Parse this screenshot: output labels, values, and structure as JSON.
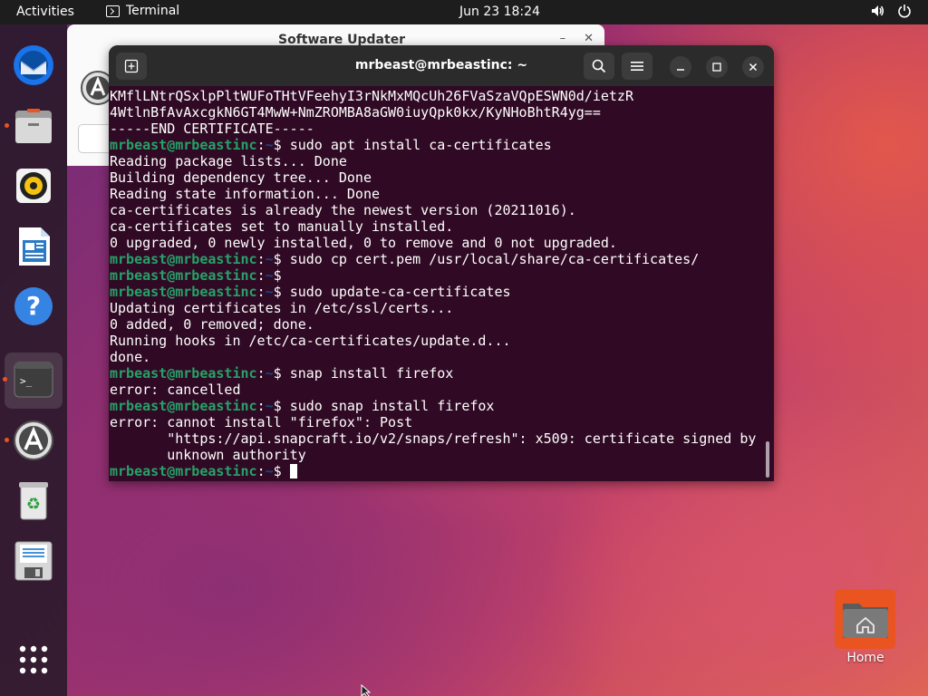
{
  "topbar": {
    "activities": "Activities",
    "app_name": "Terminal",
    "clock": "Jun 23  18:24"
  },
  "dock": {
    "items": [
      "thunderbird-icon",
      "files-icon",
      "rhythmbox-icon",
      "libreoffice-writer-icon",
      "help-icon",
      "terminal-icon",
      "software-updater-icon",
      "trash-icon",
      "floppy-save-icon",
      "show-apps-icon"
    ]
  },
  "updater": {
    "title": "Software Updater"
  },
  "terminal": {
    "title": "mrbeast@mrbeastinc: ~",
    "prompt_user": "mrbeast@mrbeastinc",
    "prompt_sep": ":",
    "prompt_path": "~",
    "prompt_end": "$ ",
    "lines": [
      {
        "kind": "out",
        "text": "KMflLNtrQSxlpPltWUFoTHtVFeehyI3rNkMxMQcUh26FVaSzaVQpESWN0d/ietzR"
      },
      {
        "kind": "out",
        "text": "4WtlnBfAvAxcgkN6GT4MwW+NmZROMBA8aGW0iuyQpk0kx/KyNHoBhtR4yg=="
      },
      {
        "kind": "out",
        "text": "-----END CERTIFICATE-----"
      },
      {
        "kind": "cmd",
        "text": "sudo apt install ca-certificates"
      },
      {
        "kind": "out",
        "text": "Reading package lists... Done"
      },
      {
        "kind": "out",
        "text": "Building dependency tree... Done"
      },
      {
        "kind": "out",
        "text": "Reading state information... Done"
      },
      {
        "kind": "out",
        "text": "ca-certificates is already the newest version (20211016)."
      },
      {
        "kind": "out",
        "text": "ca-certificates set to manually installed."
      },
      {
        "kind": "out",
        "text": "0 upgraded, 0 newly installed, 0 to remove and 0 not upgraded."
      },
      {
        "kind": "cmd",
        "text": "sudo cp cert.pem /usr/local/share/ca-certificates/"
      },
      {
        "kind": "cmd",
        "text": ""
      },
      {
        "kind": "cmd",
        "text": "sudo update-ca-certificates"
      },
      {
        "kind": "out",
        "text": "Updating certificates in /etc/ssl/certs..."
      },
      {
        "kind": "out",
        "text": "0 added, 0 removed; done."
      },
      {
        "kind": "out",
        "text": "Running hooks in /etc/ca-certificates/update.d..."
      },
      {
        "kind": "out",
        "text": "done."
      },
      {
        "kind": "cmd",
        "text": "snap install firefox"
      },
      {
        "kind": "out",
        "text": "error: cancelled"
      },
      {
        "kind": "cmd",
        "text": "sudo snap install firefox"
      },
      {
        "kind": "out",
        "text": "error: cannot install \"firefox\": Post"
      },
      {
        "kind": "out",
        "text": "       \"https://api.snapcraft.io/v2/snaps/refresh\": x509: certificate signed by"
      },
      {
        "kind": "out",
        "text": "       unknown authority"
      },
      {
        "kind": "cursor",
        "text": ""
      }
    ]
  },
  "desktop": {
    "home_label": "Home"
  },
  "colors": {
    "terminal_bg": "#300a24",
    "prompt_user": "#26a269",
    "prompt_path": "#12488b",
    "accent": "#e95420"
  }
}
